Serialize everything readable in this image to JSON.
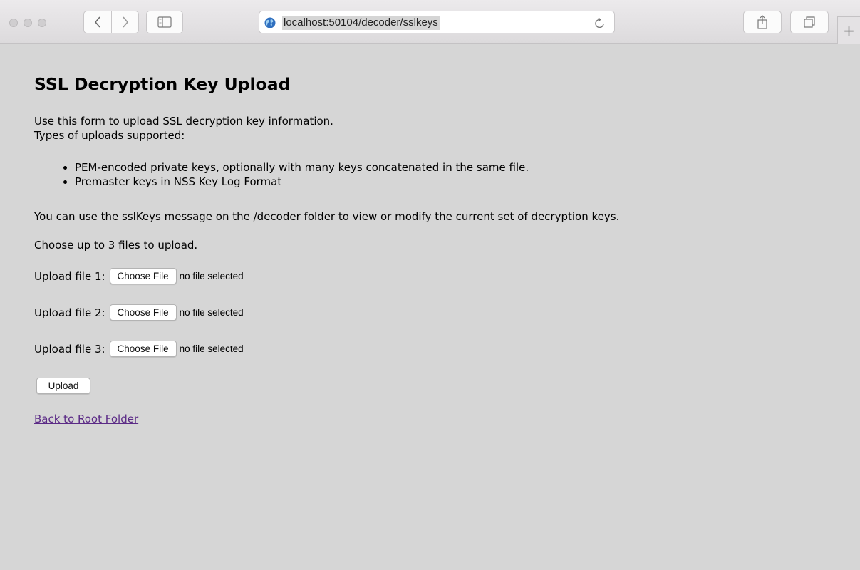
{
  "browser": {
    "url": "localhost:50104/decoder/sslkeys",
    "new_tab_label": "+"
  },
  "page": {
    "title": "SSL Decryption Key Upload",
    "intro_line1": "Use this form to upload SSL decryption key information.",
    "intro_line2": "Types of uploads supported:",
    "upload_types": [
      "PEM-encoded private keys, optionally with many keys concatenated in the same file.",
      "Premaster keys in NSS Key Log Format"
    ],
    "info": "You can use the sslKeys message on the /decoder folder to view or modify the current set of decryption keys.",
    "choose_text": "Choose up to 3 files to upload.",
    "files": [
      {
        "label": "Upload file 1:",
        "button": "Choose File",
        "status": "no file selected"
      },
      {
        "label": "Upload file 2:",
        "button": "Choose File",
        "status": "no file selected"
      },
      {
        "label": "Upload file 3:",
        "button": "Choose File",
        "status": "no file selected"
      }
    ],
    "upload_button": "Upload",
    "back_link": "Back to Root Folder"
  },
  "colors": {
    "page_background": "#d6d6d6",
    "link": "#5b2a86"
  }
}
